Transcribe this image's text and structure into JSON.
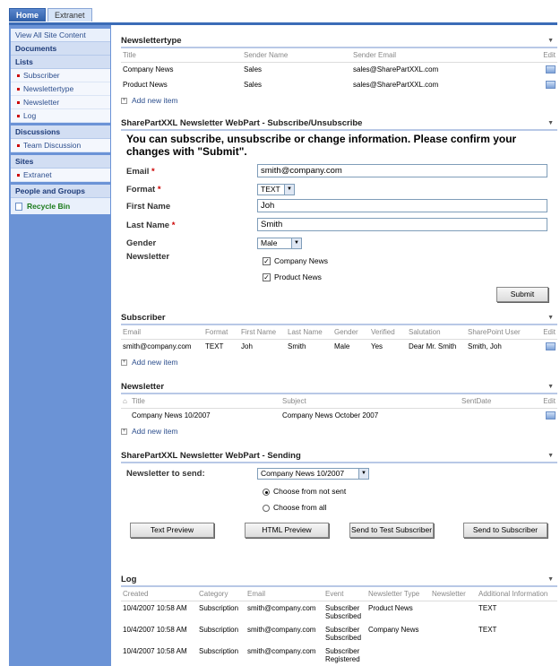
{
  "tabs": [
    {
      "label": "Home"
    },
    {
      "label": "Extranet"
    }
  ],
  "nav": {
    "view_all": "View All Site Content",
    "documents": "Documents",
    "lists": "Lists",
    "list_items": [
      "Subscriber",
      "Newslettertype",
      "Newsletter",
      "Log"
    ],
    "discussions": "Discussions",
    "discussion_items": [
      "Team Discussion"
    ],
    "sites": "Sites",
    "site_items": [
      "Extranet"
    ],
    "people": "People and Groups",
    "recycle": "Recycle Bin"
  },
  "newslettertype": {
    "title": "Newslettertype",
    "columns": [
      "Title",
      "Sender Name",
      "Sender Email",
      "Edit"
    ],
    "rows": [
      {
        "title": "Company News",
        "sender": "Sales",
        "email": "sales@SharePartXXL.com"
      },
      {
        "title": "Product News",
        "sender": "Sales",
        "email": "sales@SharePartXXL.com"
      }
    ],
    "add_new": "Add new item"
  },
  "subscribe": {
    "title": "SharePartXXL Newsletter WebPart - Subscribe/Unsubscribe",
    "intro": "You can subscribe, unsubscribe or change information. Please confirm your changes with \"Submit\".",
    "email_label": "Email",
    "email_value": "smith@company.com",
    "format_label": "Format",
    "format_value": "TEXT",
    "first_label": "First Name",
    "first_value": "Joh",
    "last_label": "Last Name",
    "last_value": "Smith",
    "gender_label": "Gender",
    "gender_value": "Male",
    "newsletter_label": "Newsletter",
    "options": [
      {
        "label": "Company News",
        "checked": true
      },
      {
        "label": "Product News",
        "checked": true
      }
    ],
    "submit": "Submit"
  },
  "subscriber": {
    "title": "Subscriber",
    "columns": [
      "Email",
      "Format",
      "First Name",
      "Last Name",
      "Gender",
      "Verified",
      "Salutation",
      "SharePoint User",
      "Edit"
    ],
    "row": {
      "email": "smith@company.com",
      "format": "TEXT",
      "first": "Joh",
      "last": "Smith",
      "gender": "Male",
      "verified": "Yes",
      "salutation": "Dear Mr. Smith",
      "user": "Smith, Joh"
    },
    "add_new": "Add new item"
  },
  "newsletter": {
    "title": "Newsletter",
    "columns": [
      "Title",
      "Subject",
      "SentDate",
      "Edit"
    ],
    "row": {
      "title": "Company News 10/2007",
      "subject": "Company News October 2007",
      "sent": ""
    },
    "add_new": "Add new item"
  },
  "sending": {
    "title": "SharePartXXL Newsletter WebPart - Sending",
    "to_send_label": "Newsletter to send:",
    "to_send_value": "Company News 10/2007",
    "radio1": "Choose from not sent",
    "radio2": "Choose from all",
    "radio_selected": "Choose from not sent",
    "buttons": [
      "Text Preview",
      "HTML Preview",
      "Send to Test Subscriber",
      "Send to Subscriber"
    ]
  },
  "log": {
    "title": "Log",
    "columns": [
      "Created",
      "Category",
      "Email",
      "Event",
      "Newsletter Type",
      "Newsletter",
      "Additional Information"
    ],
    "rows": [
      {
        "created": "10/4/2007 10:58 AM",
        "category": "Subscription",
        "email": "smith@company.com",
        "event": "Subscriber Subscribed",
        "type": "Product News",
        "newsletter": "",
        "info": "TEXT"
      },
      {
        "created": "10/4/2007 10:58 AM",
        "category": "Subscription",
        "email": "smith@company.com",
        "event": "Subscriber Subscribed",
        "type": "Company News",
        "newsletter": "",
        "info": "TEXT"
      },
      {
        "created": "10/4/2007 10:58 AM",
        "category": "Subscription",
        "email": "smith@company.com",
        "event": "Subscriber Registered",
        "type": "",
        "newsletter": "",
        "info": ""
      }
    ]
  }
}
